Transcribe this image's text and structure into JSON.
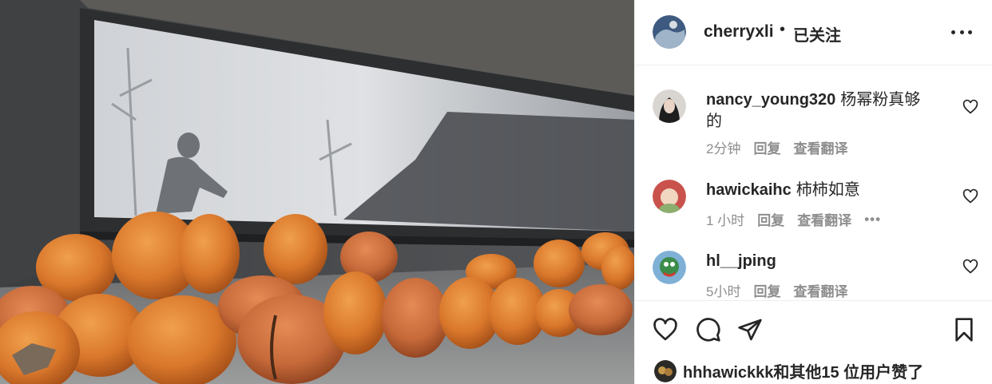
{
  "post": {
    "photo_icon": "photo",
    "author": {
      "username": "cherryxli",
      "separator": "•",
      "follow_status": "已关注"
    },
    "more_icon": "more-horizontal-icon"
  },
  "comments": [
    {
      "username": "nancy_young320",
      "text": "杨幂粉真够的",
      "time": "2分钟",
      "reply": "回复",
      "translate": "查看翻译",
      "avatar_color": "#2b2b2b"
    },
    {
      "username": "hawickaihc",
      "text": "柿柿如意",
      "time": "1 小时",
      "reply": "回复",
      "translate": "查看翻译",
      "more": "•••",
      "avatar_color": "#c9524c"
    },
    {
      "username": "hl__jping",
      "text": "",
      "time": "5小时",
      "reply": "回复",
      "translate": "查看翻译",
      "avatar_color": "#7fb0d6"
    }
  ],
  "actions": {
    "like_icon": "heart-icon",
    "comment_icon": "comment-icon",
    "share_icon": "paper-plane-icon",
    "save_icon": "bookmark-icon"
  },
  "likes": {
    "text": "hhhawickkk和其他15 位用户赞了"
  },
  "colors": {
    "text": "#262626",
    "muted": "#8e8e8e",
    "divider": "#efefef",
    "persimmon": "#d9772b"
  }
}
